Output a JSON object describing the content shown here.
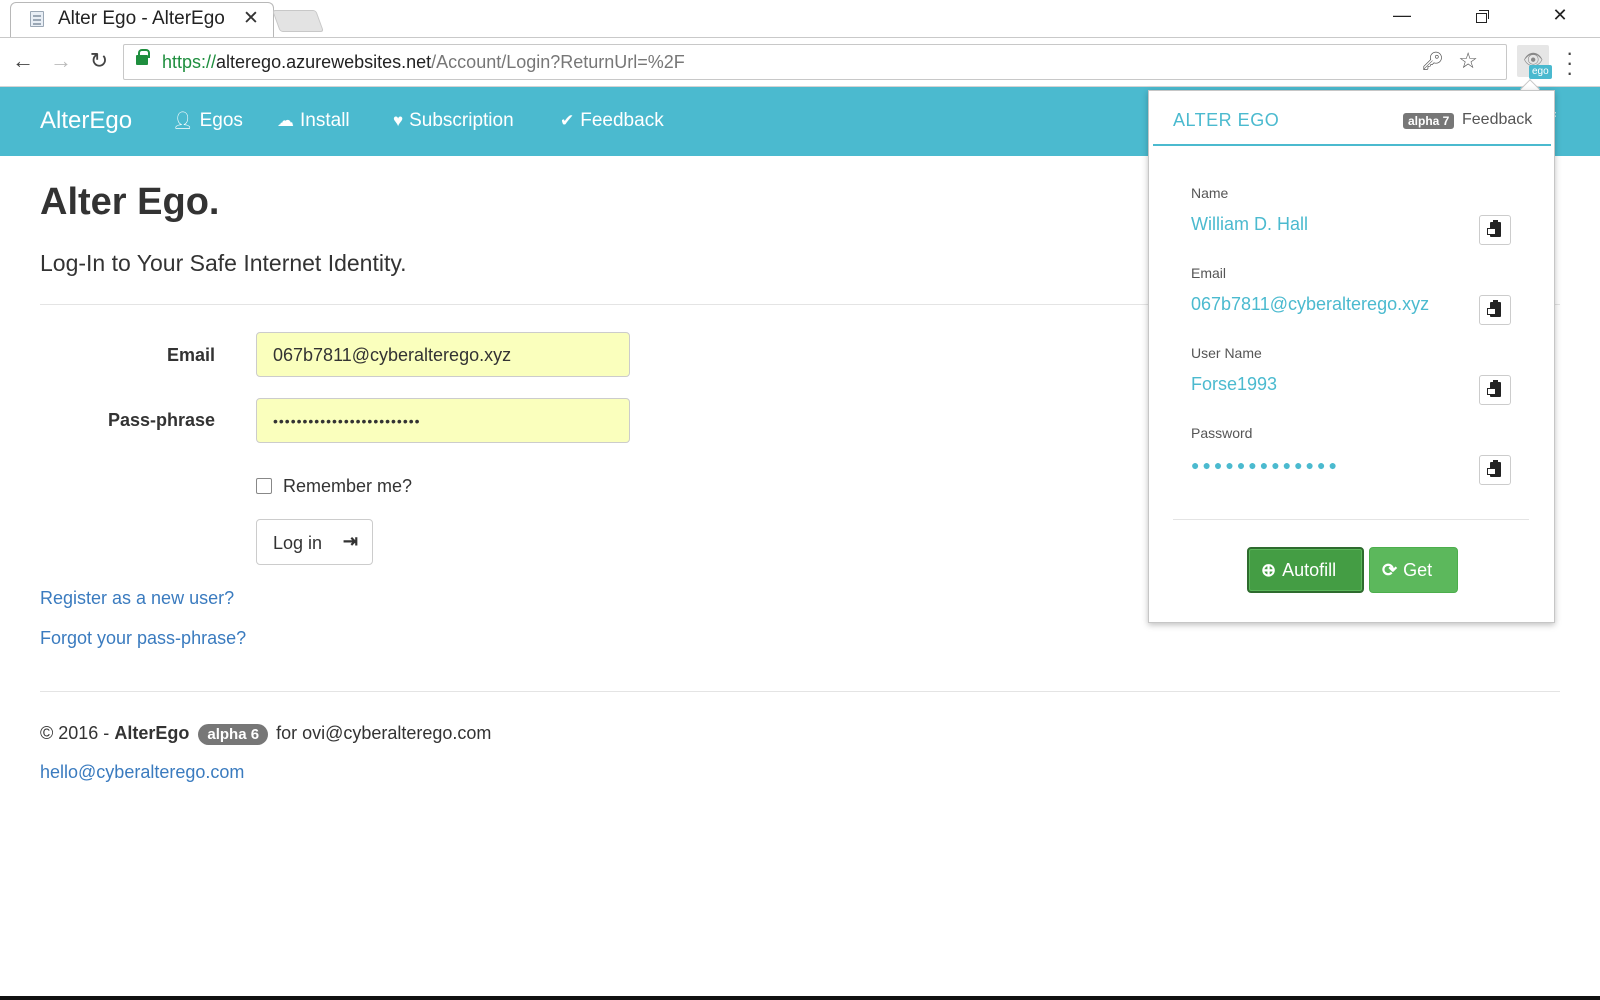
{
  "browser": {
    "tab_title": "Alter Ego - AlterEgo",
    "tab_close": "✕",
    "url_scheme": "https://",
    "url_host": "alterego.azurewebsites.net",
    "url_path": "/Account/Login?ReturnUrl=%2F",
    "window_min": "—",
    "window_close": "✕",
    "extension_badge": "ego"
  },
  "navbar": {
    "brand": "AlterEgo",
    "items": [
      {
        "label": "Egos",
        "icon": "user-icon"
      },
      {
        "label": "Install",
        "icon": "cloud-download-icon"
      },
      {
        "label": "Subscription",
        "icon": "heart-icon"
      },
      {
        "label": "Feedback",
        "icon": "check-circle-icon"
      }
    ],
    "logoff_partial": "off"
  },
  "page": {
    "title": "Alter Ego.",
    "subtitle": "Log-In to Your Safe Internet Identity.",
    "form": {
      "email_label": "Email",
      "email_value": "067b7811@cyberalterego.xyz",
      "pass_label": "Pass-phrase",
      "pass_value": "•••••••••••••••••••••••••",
      "remember_label": "Remember me?",
      "remember_checked": false,
      "login_label": "Log in"
    },
    "links": {
      "register": "Register as a new user?",
      "forgot": "Forgot your pass-phrase?"
    },
    "footer": {
      "copyright": "© 2016 -",
      "brand": "AlterEgo",
      "badge": "alpha 6",
      "for_text": "for ovi@cyberalterego.com",
      "contact": "hello@cyberalterego.com"
    }
  },
  "popup": {
    "title": "ALTER EGO",
    "badge": "alpha 7",
    "feedback": "Feedback",
    "fields": [
      {
        "label": "Name",
        "value": "William D. Hall"
      },
      {
        "label": "Email",
        "value": "067b7811@cyberalterego.xyz"
      },
      {
        "label": "User Name",
        "value": "Forse1993"
      },
      {
        "label": "Password",
        "value": "●●●●●●●●●●●●●"
      }
    ],
    "autofill_label": "Autofill",
    "get_label": "Get"
  },
  "colors": {
    "accent": "#4bbacf",
    "success": "#5cb85c",
    "link": "#3a7bbf",
    "autofill_bg": "#faffbd"
  }
}
